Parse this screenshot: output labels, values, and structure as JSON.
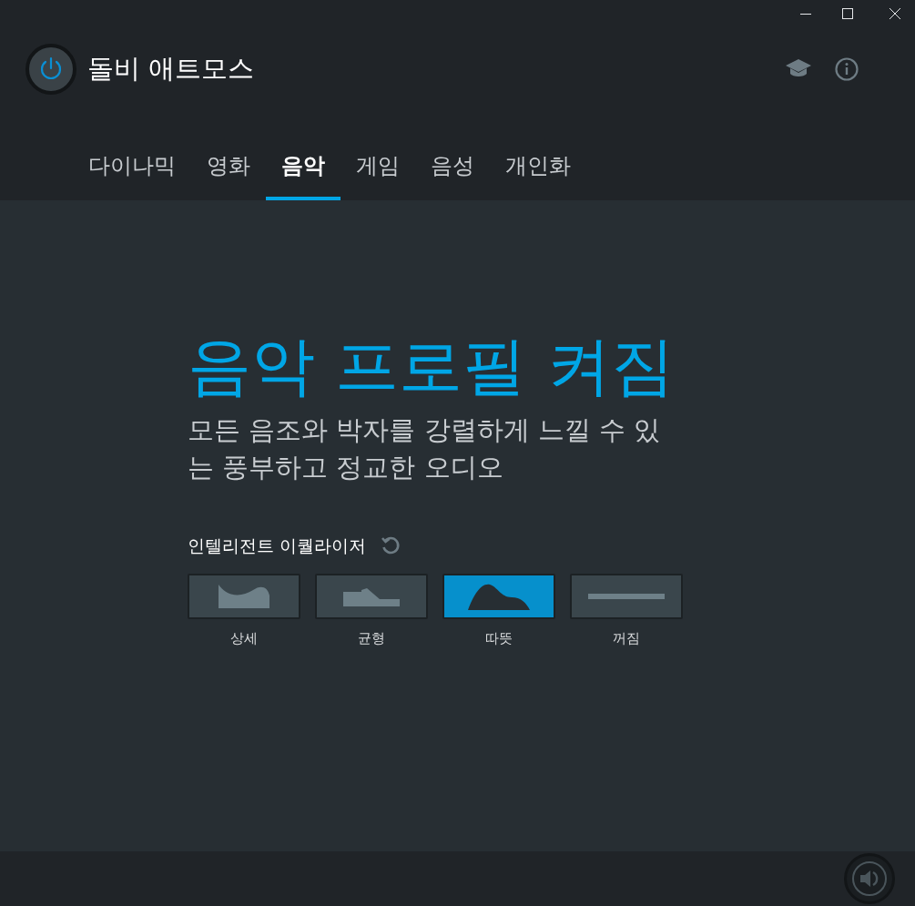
{
  "app": {
    "title": "돌비 애트모스",
    "power_on": true
  },
  "tabs": [
    {
      "label": "다이나믹",
      "selected": false
    },
    {
      "label": "영화",
      "selected": false
    },
    {
      "label": "음악",
      "selected": true
    },
    {
      "label": "게임",
      "selected": false
    },
    {
      "label": "음성",
      "selected": false
    },
    {
      "label": "개인화",
      "selected": false
    }
  ],
  "profile": {
    "heading": "음악 프로필 켜짐",
    "description": "모든 음조와 박자를 강렬하게 느낄 수 있는 풍부하고 정교한 오디오"
  },
  "equalizer": {
    "label": "인텔리전트 이퀄라이저",
    "presets": [
      {
        "kind": "detailed",
        "label": "상세",
        "selected": false
      },
      {
        "kind": "balanced",
        "label": "균형",
        "selected": false
      },
      {
        "kind": "warm",
        "label": "따뜻",
        "selected": true
      },
      {
        "kind": "off",
        "label": "꺼짐",
        "selected": false
      }
    ]
  }
}
